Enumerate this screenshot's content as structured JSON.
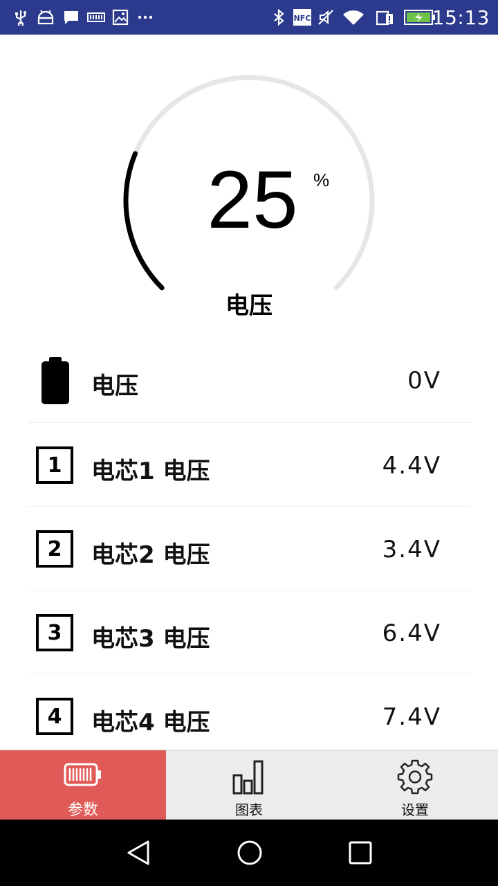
{
  "status_bar": {
    "time": "15:13",
    "background": "#2b3a8c",
    "left_icons": [
      "usb-icon",
      "android-icon",
      "message-icon",
      "keyboard-icon",
      "image-icon",
      "more-dots-icon"
    ],
    "right_icons": [
      "bluetooth-icon",
      "nfc-icon",
      "muted-icon",
      "wifi-icon",
      "sim-icon",
      "battery-charging-icon"
    ],
    "nfc_text": "NFC"
  },
  "gauge": {
    "value": "25",
    "unit": "%",
    "label": "电压",
    "progress_percent": 25,
    "track_color": "#e6e6e6",
    "progress_color": "#000000"
  },
  "rows": [
    {
      "icon": "battery-icon",
      "label": "电压",
      "value": "0V"
    },
    {
      "icon": "number-1-icon",
      "badge": "1",
      "label": "电芯1 电压",
      "value": "4.4V"
    },
    {
      "icon": "number-2-icon",
      "badge": "2",
      "label": "电芯2 电压",
      "value": "3.4V"
    },
    {
      "icon": "number-3-icon",
      "badge": "3",
      "label": "电芯3 电压",
      "value": "6.4V"
    },
    {
      "icon": "number-4-icon",
      "badge": "4",
      "label": "电芯4 电压",
      "value": "7.4V"
    }
  ],
  "bottom_nav": {
    "active_color": "#e05a57",
    "tabs": [
      {
        "icon": "battery-icon",
        "label": "参数",
        "active": true
      },
      {
        "icon": "bar-chart-icon",
        "label": "图表",
        "active": false
      },
      {
        "icon": "gear-icon",
        "label": "设置",
        "active": false
      }
    ]
  },
  "system_nav": {
    "buttons": [
      "back-icon",
      "home-icon",
      "recents-icon"
    ]
  }
}
